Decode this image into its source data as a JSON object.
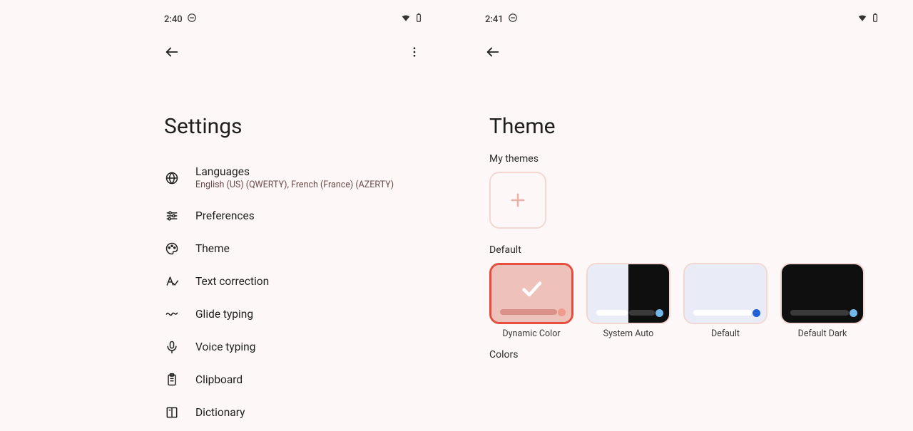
{
  "left": {
    "status": {
      "time": "2:40"
    },
    "title": "Settings",
    "items": [
      {
        "label": "Languages",
        "sub": "English (US) (QWERTY), French (France) (AZERTY)"
      },
      {
        "label": "Preferences"
      },
      {
        "label": "Theme"
      },
      {
        "label": "Text correction"
      },
      {
        "label": "Glide typing"
      },
      {
        "label": "Voice typing"
      },
      {
        "label": "Clipboard"
      },
      {
        "label": "Dictionary"
      }
    ]
  },
  "right": {
    "status": {
      "time": "2:41"
    },
    "title": "Theme",
    "my_themes_label": "My themes",
    "default_label": "Default",
    "colors_label": "Colors",
    "themes": [
      {
        "name": "Dynamic Color"
      },
      {
        "name": "System Auto"
      },
      {
        "name": "Default"
      },
      {
        "name": "Default Dark"
      }
    ]
  }
}
